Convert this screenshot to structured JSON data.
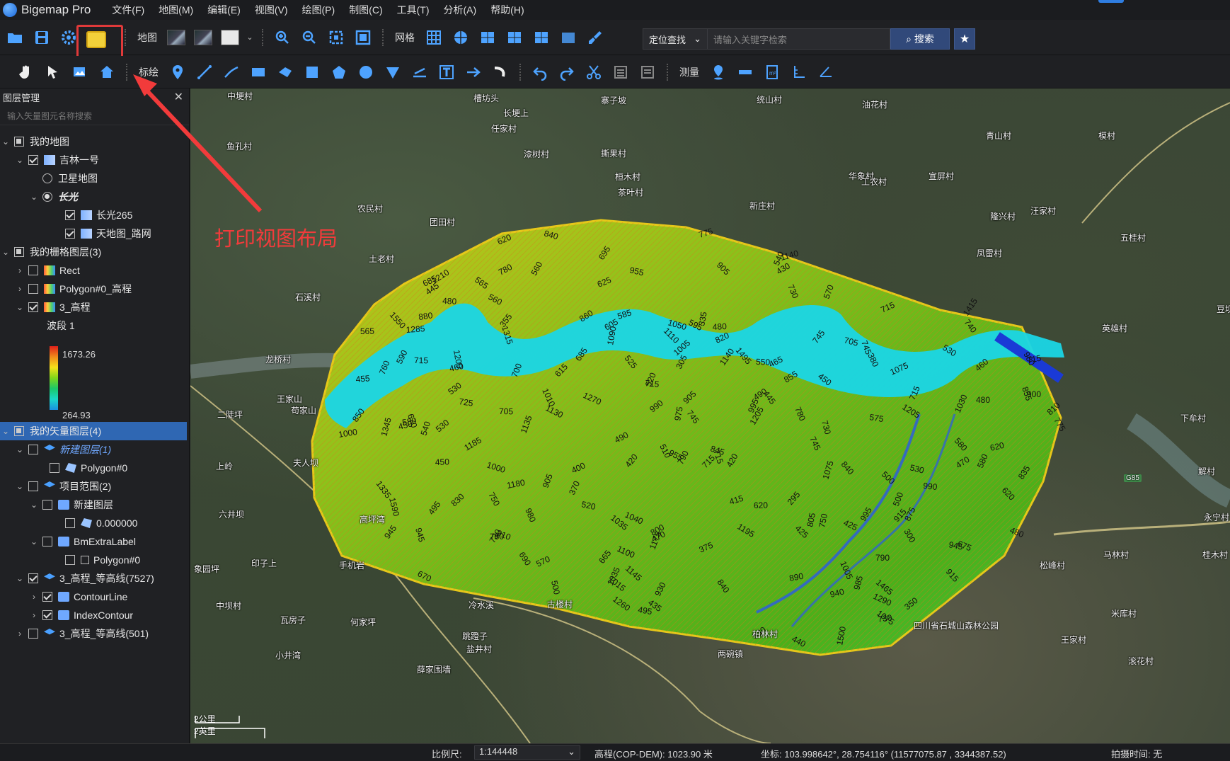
{
  "app": {
    "title": "Bigemap Pro"
  },
  "menu": [
    "文件(F)",
    "地图(M)",
    "编辑(E)",
    "视图(V)",
    "绘图(P)",
    "制图(C)",
    "工具(T)",
    "分析(A)",
    "帮助(H)"
  ],
  "toolbar1": {
    "map_label": "地图",
    "grid_label": "网格"
  },
  "toolbar2": {
    "draw_label": "标绘",
    "measure_label": "测量"
  },
  "search": {
    "type": "定位查找",
    "placeholder": "请输入关键字检索",
    "button": "搜索"
  },
  "sidebar": {
    "title": "图层管理",
    "search_placeholder": "输入矢量图元名称搜索",
    "tree": [
      {
        "label": "我的地图"
      },
      {
        "label": "吉林一号"
      },
      {
        "label": "卫星地图"
      },
      {
        "label": "长光"
      },
      {
        "label": "长光265"
      },
      {
        "label": "天地图_路网"
      },
      {
        "label": "我的栅格图层(3)"
      },
      {
        "label": "Rect"
      },
      {
        "label": "Polygon#0_高程"
      },
      {
        "label": "3_高程"
      },
      {
        "label": "波段 1"
      },
      {
        "label": "我的矢量图层(4)"
      },
      {
        "label": "新建图层(1)"
      },
      {
        "label": "Polygon#0"
      },
      {
        "label": "项目范围(2)"
      },
      {
        "label": "新建图层"
      },
      {
        "label": "0.000000"
      },
      {
        "label": "BmExtraLabel"
      },
      {
        "label": "Polygon#0"
      },
      {
        "label": "3_高程_等高线(7527)"
      },
      {
        "label": "ContourLine"
      },
      {
        "label": "IndexContour"
      },
      {
        "label": "3_高程_等高线(501)"
      }
    ],
    "legend": {
      "max": "1673.26",
      "min": "264.93"
    }
  },
  "annotation": {
    "text": "打印视图布局",
    "color": "#f23b3b"
  },
  "map": {
    "places": [
      "中埂村",
      "槽坊头",
      "寨子坡",
      "统山村",
      "长埂上",
      "任家村",
      "油花村",
      "鱼孔村",
      "漆树村",
      "撕果村",
      "青山村",
      "模村",
      "桓木村",
      "华象村",
      "宣屏村",
      "茶叶村",
      "工农村",
      "新庄村",
      "汪家村",
      "农民村",
      "团田村",
      "隆兴村",
      "五桂村",
      "土老村",
      "凤雷村",
      "石溪村",
      "豆坝",
      "英雄村",
      "龙桥村",
      "王家山",
      "苟家山",
      "二陡坪",
      "下牟村",
      "夫人坝",
      "上岭",
      "解村",
      "六井坝",
      "高坪湾",
      "永宁村",
      "印子上",
      "手机岩",
      "马林村",
      "松峰村",
      "桂木村",
      "象园坪",
      "中坝村",
      "冷水溪",
      "古楼村",
      "瓦房子",
      "何家坪",
      "跳蹬子",
      "柏林村",
      "四川省石城山森林公园",
      "米库村",
      "王家村",
      "盐井村",
      "两碗镇",
      "小井湾",
      "滚花村",
      "薛家围墙"
    ],
    "contour_labels": [
      "790",
      "705",
      "490",
      "500",
      "595",
      "450",
      "670",
      "725",
      "745",
      "810",
      "1140",
      "1075",
      "1050",
      "1100",
      "880",
      "1040",
      "715",
      "745",
      "990",
      "730",
      "690",
      "675",
      "615",
      "1035",
      "995",
      "775",
      "1205",
      "350",
      "425",
      "740",
      "840",
      "540",
      "1135",
      "860",
      "1140",
      "450",
      "470",
      "480",
      "700",
      "840",
      "715",
      "620",
      "745",
      "730",
      "480",
      "1005",
      "890",
      "415",
      "790",
      "435",
      "455",
      "495",
      "1185",
      "775",
      "830",
      "380",
      "445",
      "460",
      "580",
      "530",
      "490",
      "575",
      "585",
      "985",
      "820",
      "780",
      "750",
      "855",
      "715",
      "565",
      "530",
      "685",
      "620",
      "705",
      "945",
      "465",
      "420",
      "1015",
      "845",
      "695",
      "730",
      "1030",
      "460",
      "620",
      "990",
      "850",
      "1005",
      "715",
      "620",
      "975",
      "540",
      "1130",
      "945",
      "905",
      "855",
      "835",
      "750",
      "780",
      "565",
      "715",
      "760",
      "685",
      "590",
      "525",
      "510",
      "450",
      "1110",
      "1180",
      "930",
      "905",
      "915",
      "1175",
      "1090",
      "800",
      "1000",
      "1205",
      "1010",
      "940",
      "665",
      "530",
      "370",
      "520",
      "335",
      "1315",
      "910",
      "1035",
      "1290",
      "1200",
      "1000",
      "1285",
      "1345",
      "1195",
      "980",
      "805",
      "715",
      "500",
      "560",
      "570",
      "605",
      "500",
      "715",
      "840",
      "1495",
      "1465",
      "1075",
      "580",
      "625",
      "355",
      "445",
      "305",
      "570",
      "550",
      "1335",
      "900",
      "730",
      "480",
      "295",
      "300",
      "520",
      "1075",
      "1260",
      "1500",
      "1590",
      "980",
      "1550",
      "915",
      "955",
      "945",
      "670",
      "430",
      "495",
      "375",
      "560",
      "530",
      "1270",
      "1415",
      "955",
      "780",
      "480",
      "1145",
      "875",
      "745",
      "440",
      "400",
      "470",
      "1210",
      "425",
      "995",
      "580",
      "420",
      "530",
      "905"
    ],
    "scale_km": "2公里",
    "scale_mi": "2英里",
    "road_badge": "G85"
  },
  "status": {
    "scale_label": "比例尺:",
    "scale_value": "1:144448",
    "elevation": "高程(COP-DEM): 1023.90 米",
    "coords": "坐标: 103.998642°, 28.754116°  (11577075.87 , 3344387.52)",
    "capture_time": "拍摄时间: 无"
  }
}
